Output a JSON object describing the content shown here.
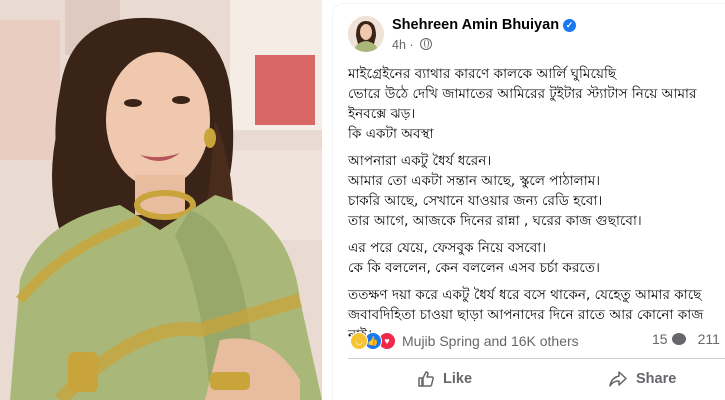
{
  "post": {
    "author": "Shehreen Amin Bhuiyan",
    "time": "4h",
    "lines": [
      "মাইগ্রেইনের ব্যাথার কারণে কালকে আর্লি ঘুমিয়েছি",
      "ভোরে উঠে দেখি জামাতের আমিরের টুইটার স্ট্যাটাস নিয়ে আমার",
      "ইনবক্সে ঝড়।",
      "কি একটা অবস্থা",
      "",
      "আপনারা একটু ধৈর্য ধরেন।",
      "আমার তো একটা সন্তান আছে, স্কুলে পাঠালাম।",
      "চাকরি আছে, সেখানে যাওয়ার জন্য রেডি হবো।",
      "তার আগে, আজকে দিনের রান্না , ঘরের কাজ গুছাবো।",
      "",
      "এর পরে যেয়ে, ফেসবুক নিয়ে বসবো।",
      "কে কি বললেন, কেন বললেন এসব চর্চা করতে।",
      "",
      "ততক্ষণ দয়া করে একটু ধৈর্য ধরে বসে থাকেন, যেহেতু আমার কাছে",
      "জবাবদিহিতা চাওয়া ছাড়া আপনাদের দিনে রাতে আর কোনো কাজ",
      "নাই।"
    ]
  },
  "reactions": {
    "summary": "Mujib Spring and 16K others",
    "comments": "15",
    "shares": "211"
  },
  "actions": {
    "like": "Like",
    "share": "Share"
  },
  "colors": {
    "accent": "#1877f2",
    "muted": "#65676b",
    "saree_green": "#a9b879",
    "gold": "#c9a43b"
  }
}
